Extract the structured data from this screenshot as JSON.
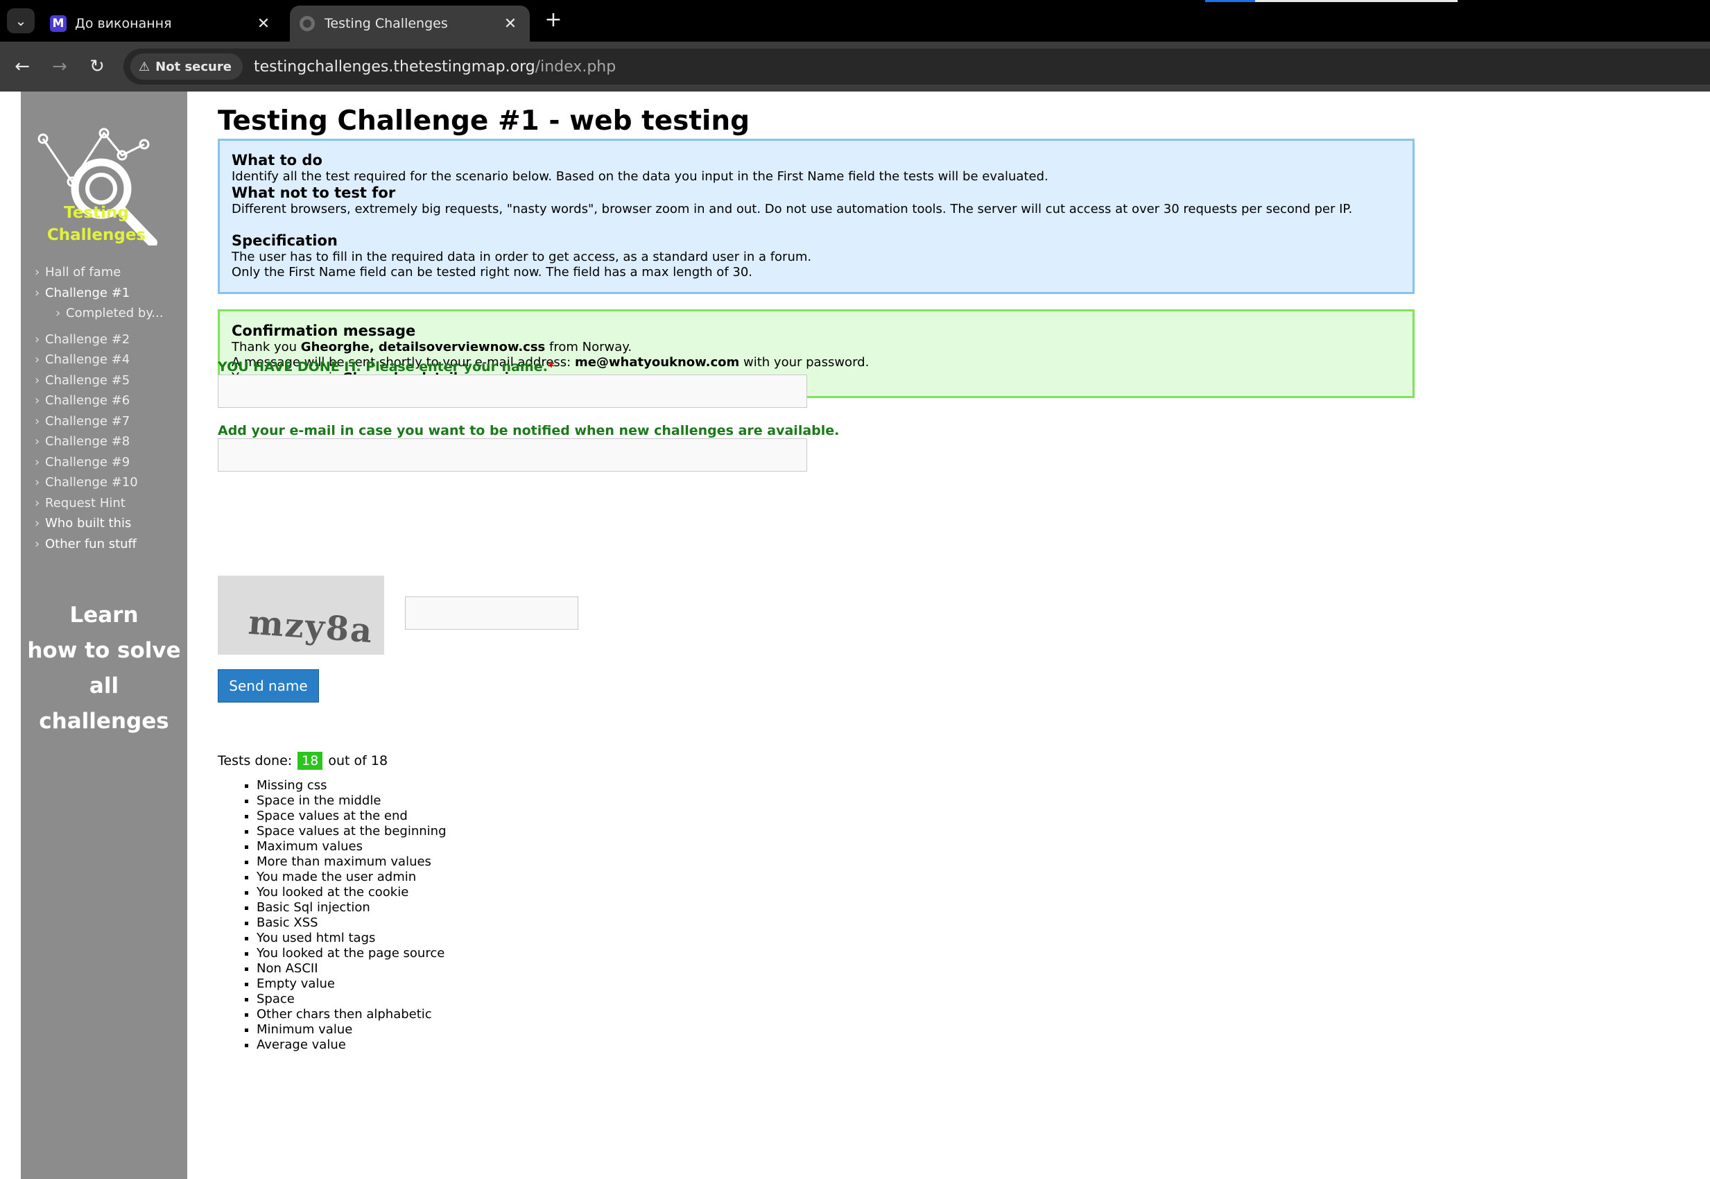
{
  "browser": {
    "tabs": [
      {
        "title": "До виконання",
        "favicon": "M"
      },
      {
        "title": "Testing Challenges",
        "favicon": "globe"
      }
    ],
    "security_label": "Not secure",
    "url_host": "testingchallenges.thetestingmap.org",
    "url_path": "/index.php"
  },
  "logo": {
    "line1": "Testing",
    "line2": "Challenges"
  },
  "sidebar": {
    "items": [
      "Hall of fame",
      "Challenge #1",
      "Completed by...",
      "Challenge #2",
      "Challenge #4",
      "Challenge #5",
      "Challenge #6",
      "Challenge #7",
      "Challenge #8",
      "Challenge #9",
      "Challenge #10",
      "Request Hint",
      "Who built this",
      "Other fun stuff"
    ],
    "learn": [
      "Learn",
      "how to solve",
      "all challenges"
    ]
  },
  "main": {
    "title": "Testing Challenge #1 - web testing",
    "info": {
      "what_to_do_heading": "What to do",
      "what_to_do_text": "Identify all the test required for the scenario below. Based on the data you input in the First Name field the tests will be evaluated.",
      "what_not_heading": "What not to test for",
      "what_not_text": "Different browsers, extremely big requests, \"nasty words\", browser zoom in and out. Do not use automation tools. The server will cut access at over 30 requests per second per IP.",
      "spec_heading": "Specification",
      "spec_line1": "The user has to fill in the required data in order to get access, as a standard user in a forum.",
      "spec_line2": "Only the First Name field can be tested right now. The field has a max length of 30."
    },
    "confirmation": {
      "heading": "Confirmation message",
      "l1_pre": "Thank you ",
      "l1_name": "Gheorghe, detailsoverviewnow.css",
      "l1_post": " from Norway.",
      "l2_pre": "A message will be sent shortly to your e-mail address: ",
      "l2_email": "me@whatyouknow.com",
      "l2_post": " with your password.",
      "l3_pre": "Your username is ",
      "l3_user": "Gheorghe_detailsoverviewnow.css."
    },
    "form": {
      "name_label": "YOU HAVE DONE IT. Please enter your name.",
      "required_mark": "*",
      "name_value": "",
      "email_label": "Add your e-mail in case you want to be notified when new challenges are available.",
      "email_value": "",
      "captcha_text": "mzy8a",
      "captcha_value": "",
      "send_label": "Send name"
    },
    "tests": {
      "prefix": "Tests done:",
      "done": "18",
      "suffix": "out of 18",
      "items": [
        "Missing css",
        "Space in the middle",
        "Space values at the end",
        "Space values at the beginning",
        "Maximum values",
        "More than maximum values",
        "You made the user admin",
        "You looked at the cookie",
        "Basic Sql injection",
        "Basic XSS",
        "You used html tags",
        "You looked at the page source",
        "Non ASCII",
        "Empty value",
        "Space",
        "Other chars then alphabetic",
        "Minimum value",
        "Average value"
      ]
    }
  }
}
